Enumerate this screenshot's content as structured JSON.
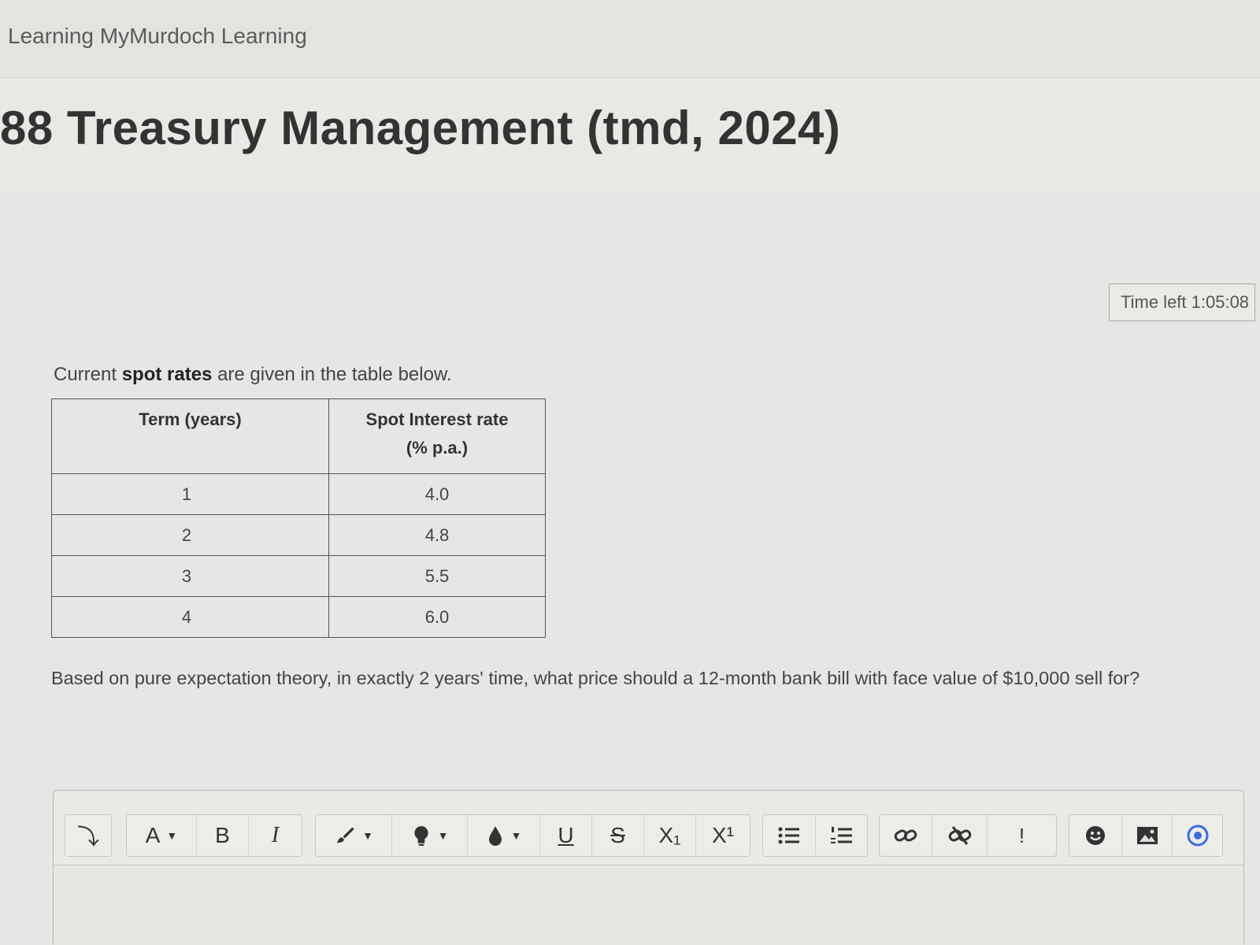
{
  "header": {
    "site_title": "Learning MyMurdoch Learning",
    "course_title": "88 Treasury Management (tmd, 2024)"
  },
  "timer": {
    "label": "Time left 1:05:08"
  },
  "question": {
    "intro_prefix": "Current ",
    "intro_bold": "spot rates",
    "intro_suffix": " are given in the table below.",
    "table": {
      "headers": [
        "Term (years)",
        "Spot Interest rate",
        "(% p.a.)"
      ],
      "rows": [
        [
          "1",
          "4.0"
        ],
        [
          "2",
          "4.8"
        ],
        [
          "3",
          "5.5"
        ],
        [
          "4",
          "6.0"
        ]
      ]
    },
    "prompt": "Based on pure expectation theory, in exactly 2 years' time, what price should a 12-month bank bill with face value of $10,000 sell for?"
  },
  "editor": {
    "toolbar": {
      "collapse": "⤵",
      "font_size": "A",
      "bold": "B",
      "italic": "I",
      "underline": "U",
      "strike": "S",
      "subscript": "X₁",
      "superscript": "X¹",
      "accessibility": "!"
    },
    "icons": [
      "arrow-down-icon",
      "paintbrush-icon",
      "lightbulb-icon",
      "droplet-icon",
      "bullet-list-icon",
      "numbered-list-icon",
      "link-icon",
      "unlink-icon",
      "emoji-icon",
      "image-icon",
      "record-icon"
    ]
  },
  "colors": {
    "background": "#e6e7e4",
    "text": "#333333",
    "record_blue": "#3a6fd8"
  }
}
